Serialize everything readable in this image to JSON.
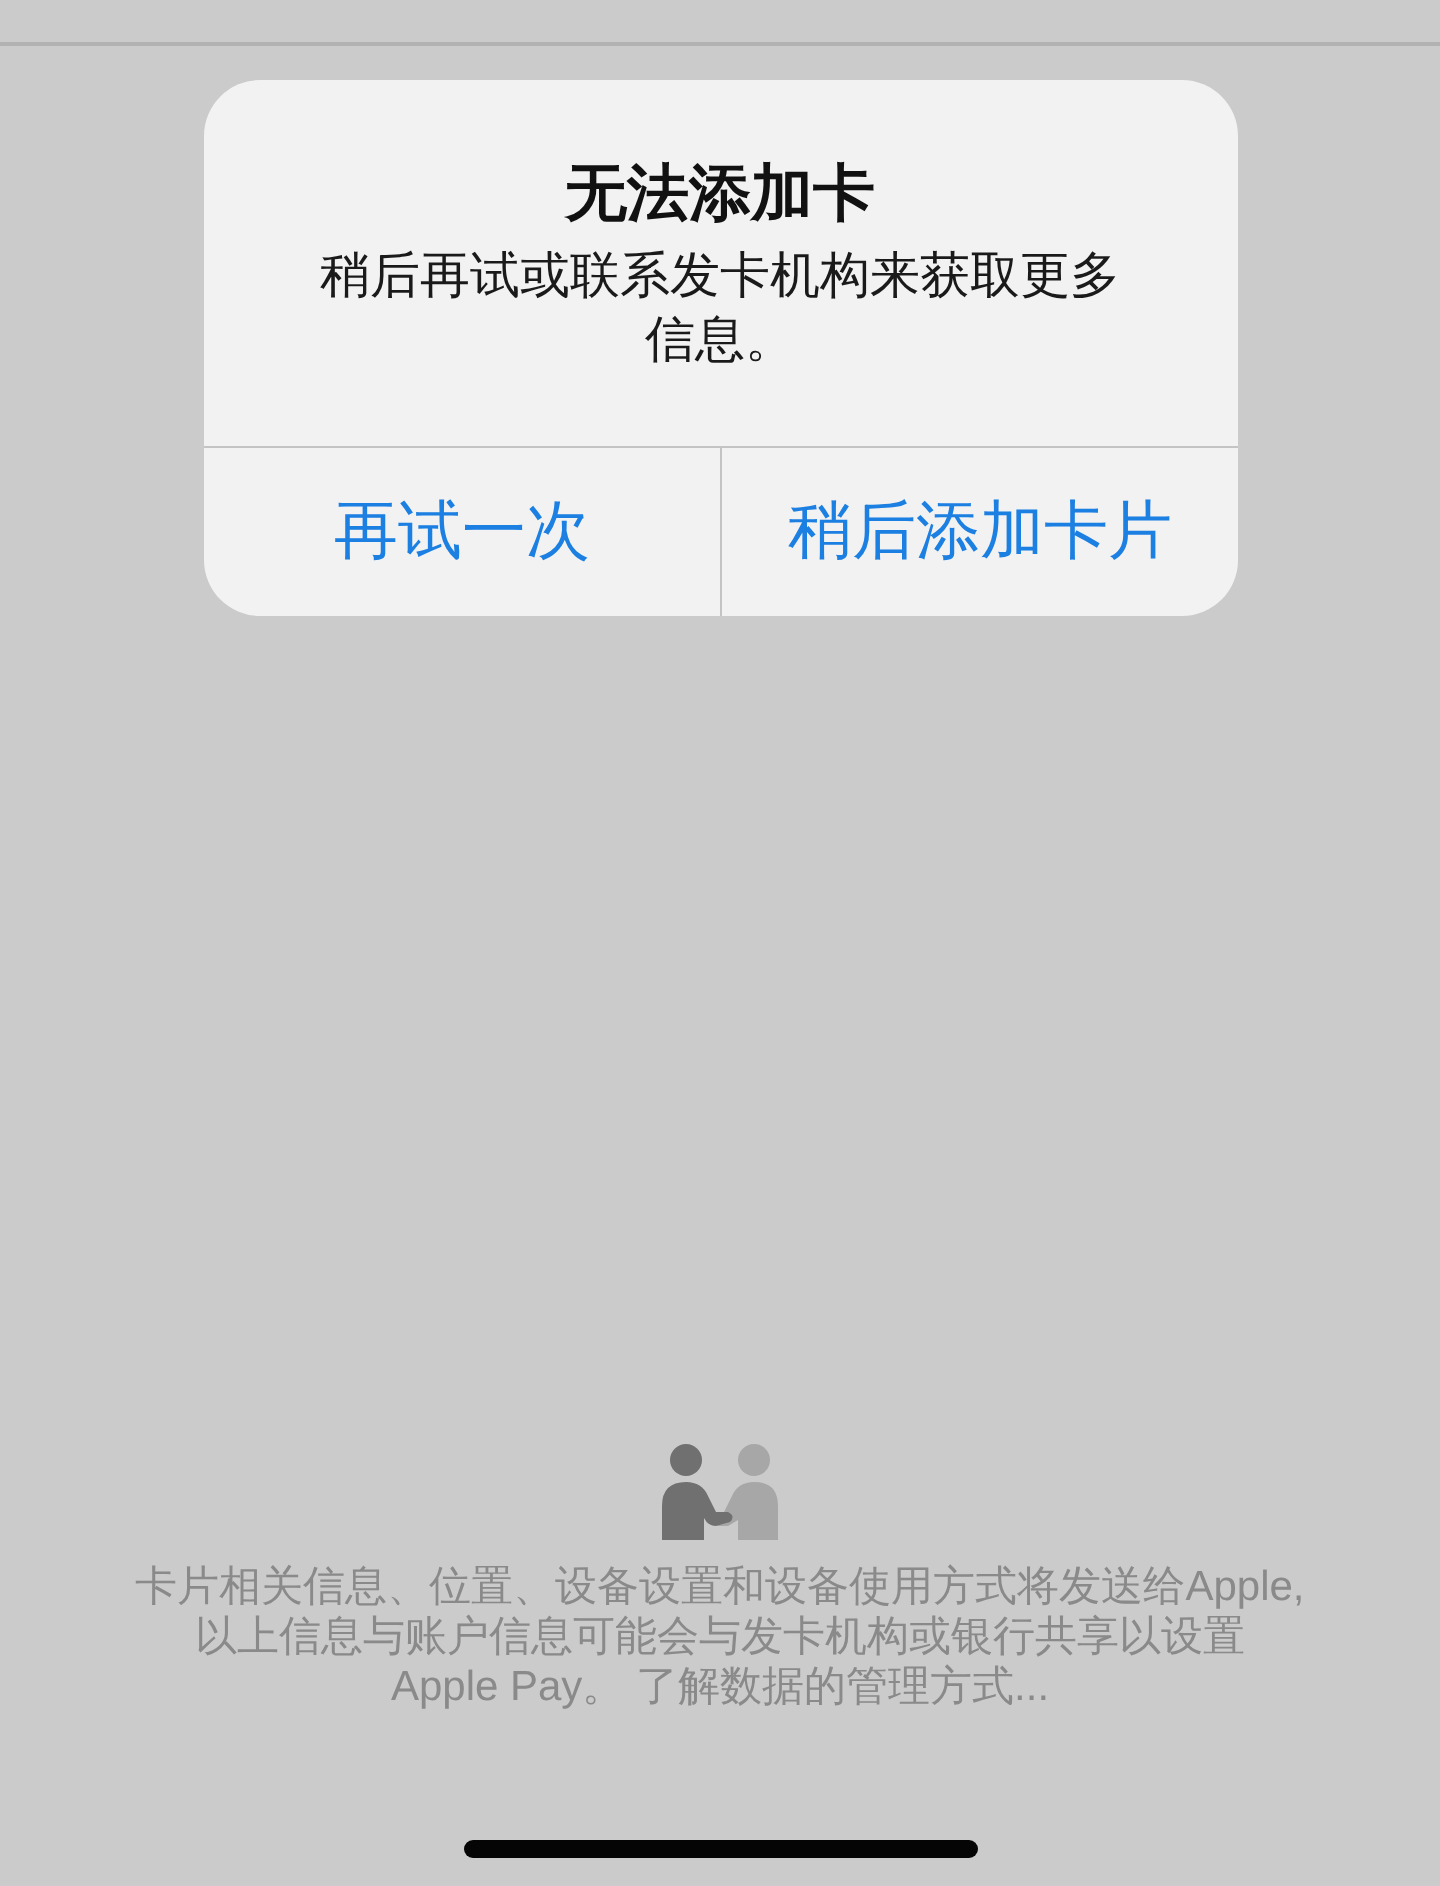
{
  "alert": {
    "title": "无法添加卡",
    "message": "稍后再试或联系发卡机构来获取更多信息。",
    "buttons": [
      "再试一次",
      "稍后添加卡片"
    ]
  },
  "privacy_notice": {
    "text": "卡片相关信息、位置、设备设置和设备使用方式将发送给Apple,以上信息与账户信息可能会与发卡机构或银行共享以设置Apple Pay。",
    "link": "了解数据的管理方式..."
  }
}
